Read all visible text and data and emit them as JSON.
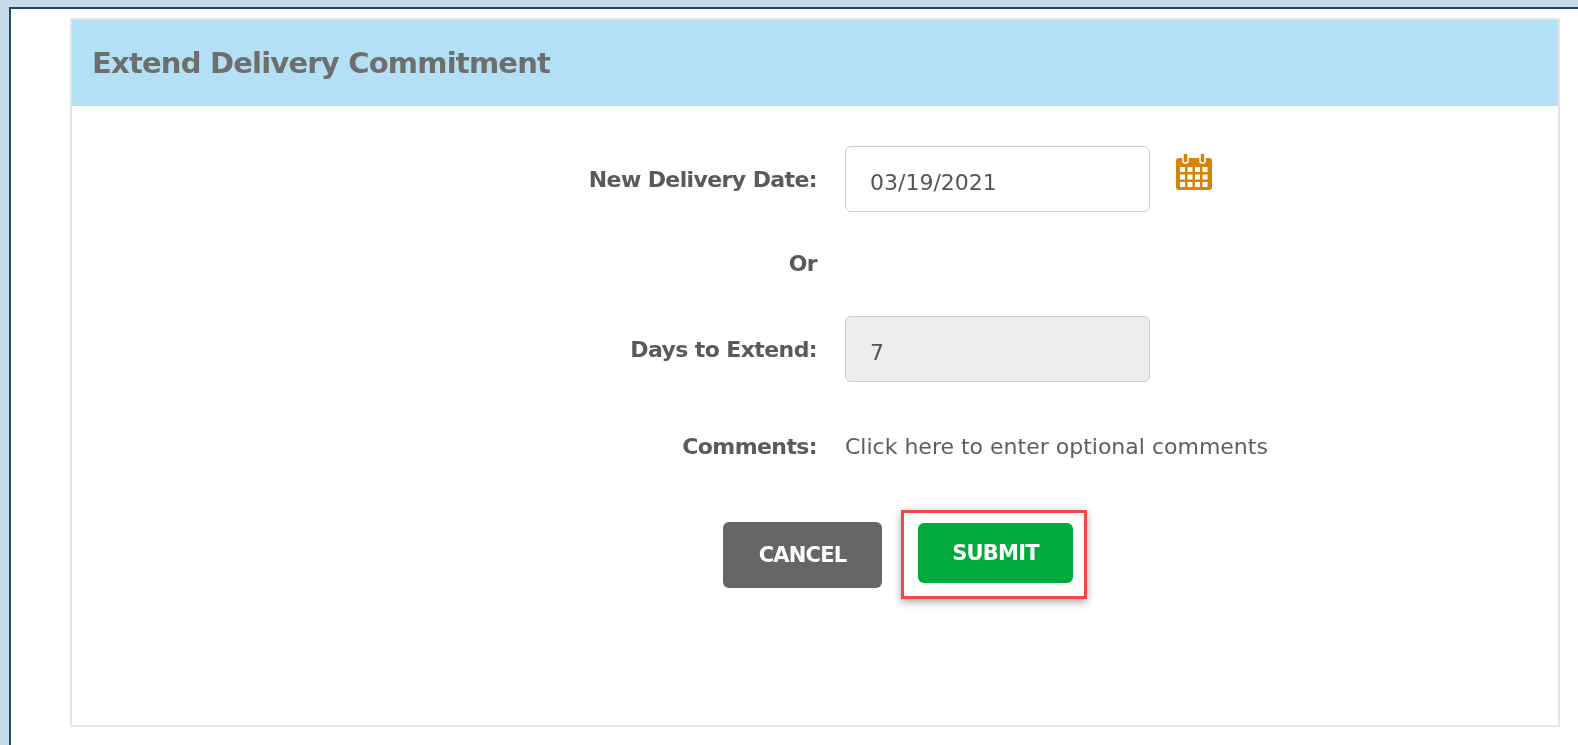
{
  "panel": {
    "title": "Extend Delivery Commitment"
  },
  "fields": [
    {
      "kind": "date",
      "label": "New Delivery Date:",
      "value": "03/19/2021",
      "disabled": false
    },
    {
      "kind": "separator",
      "label": "Or"
    },
    {
      "kind": "number",
      "label": "Days to Extend:",
      "value": "7",
      "disabled": true
    },
    {
      "kind": "comment",
      "label": "Comments:",
      "placeholder": "Click here to enter optional comments"
    }
  ],
  "buttons": [
    {
      "kind": "cancel",
      "label": "CANCEL",
      "highlighted": false
    },
    {
      "kind": "submit",
      "label": "SUBMIT",
      "highlighted": true
    }
  ]
}
